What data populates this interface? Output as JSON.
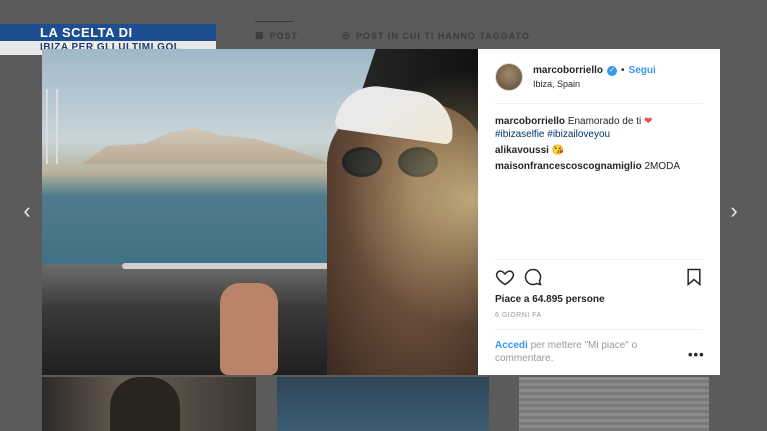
{
  "caption": {
    "title": "LA SCELTA DI BORRIELLO",
    "subtitle": "IBIZA PER GLI ULTIMI GOL"
  },
  "background_tabs": {
    "posts": "POST",
    "tagged": "POST IN CUI TI HANNO TAGGATO"
  },
  "navigation": {
    "prev": "‹",
    "next": "›"
  },
  "post": {
    "username": "marcoborriello",
    "verified": true,
    "separator": "•",
    "follow_label": "Segui",
    "location": "Ibiza, Spain",
    "caption_text": "Enamorado de ti",
    "caption_emoji": "❤",
    "hashtags": "#ibizaselfie #ibizailoveyou",
    "comments": [
      {
        "user": "alikavoussi",
        "text": "😘"
      },
      {
        "user": "maisonfrancescoscognamiglio",
        "text": "2MODA"
      }
    ],
    "likes": "Piace a 64.895 persone",
    "age": "6 GIORNI FA",
    "login_link": "Accedi",
    "login_text": "per mettere \"Mi piace\" o commentare.",
    "more_label": "•••"
  },
  "icons": {
    "heart": "heart-icon",
    "comment": "comment-icon",
    "bookmark": "bookmark-icon",
    "verified": "verified-badge-icon"
  },
  "colors": {
    "caption_bar": "#1d4e8f",
    "link_blue": "#3897f0",
    "hashtag": "#003569"
  }
}
